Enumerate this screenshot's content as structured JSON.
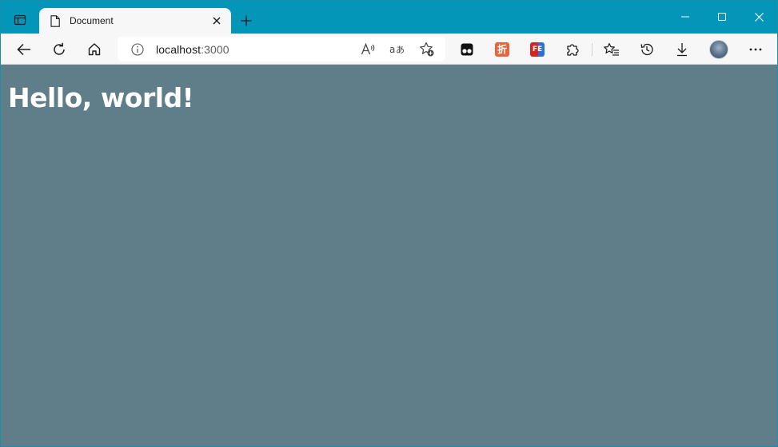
{
  "browser": {
    "tab": {
      "title": "Document",
      "close_symbol": "✕"
    },
    "new_tab_symbol": "+",
    "address": {
      "host": "localhost",
      "port": ":3000"
    },
    "extensions": {
      "zhe_label": "折",
      "fe_label": "FE"
    },
    "colors": {
      "frame": "#0496b8",
      "toolbar": "#f7f7f7",
      "content_bg": "#607d8a"
    }
  },
  "page": {
    "heading": "Hello, world!"
  }
}
